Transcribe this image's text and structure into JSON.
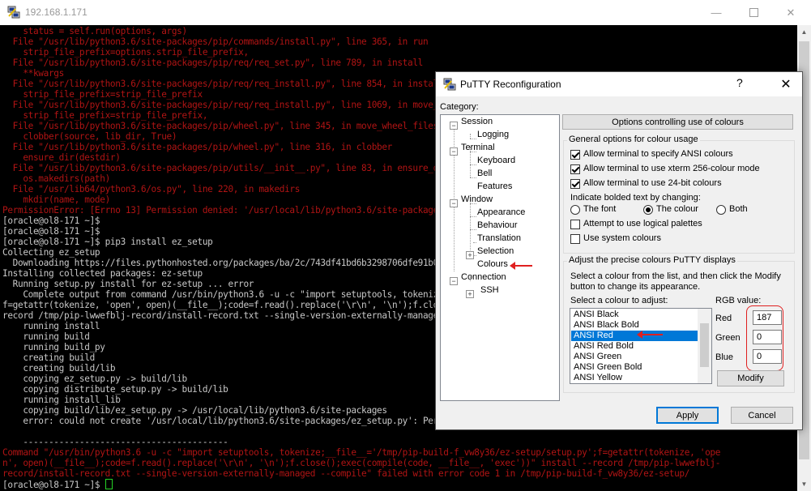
{
  "window": {
    "title": "192.168.1.171"
  },
  "terminal": {
    "lines": [
      {
        "text": "    status = self.run(options, args)",
        "color": "red"
      },
      {
        "text": "  File \"/usr/lib/python3.6/site-packages/pip/commands/install.py\", line 365, in run",
        "color": "red"
      },
      {
        "text": "    strip_file_prefix=options.strip_file_prefix,",
        "color": "red"
      },
      {
        "text": "  File \"/usr/lib/python3.6/site-packages/pip/req/req_set.py\", line 789, in install",
        "color": "red"
      },
      {
        "text": "    **kwargs",
        "color": "red"
      },
      {
        "text": "  File \"/usr/lib/python3.6/site-packages/pip/req/req_install.py\", line 854, in install",
        "color": "red"
      },
      {
        "text": "    strip_file_prefix=strip_file_prefix",
        "color": "red"
      },
      {
        "text": "  File \"/usr/lib/python3.6/site-packages/pip/req/req_install.py\", line 1069, in move_wheel_files",
        "color": "red"
      },
      {
        "text": "    strip_file_prefix=strip_file_prefix,",
        "color": "red"
      },
      {
        "text": "  File \"/usr/lib/python3.6/site-packages/pip/wheel.py\", line 345, in move_wheel_files",
        "color": "red"
      },
      {
        "text": "    clobber(source, lib_dir, True)",
        "color": "red"
      },
      {
        "text": "  File \"/usr/lib/python3.6/site-packages/pip/wheel.py\", line 316, in clobber",
        "color": "red"
      },
      {
        "text": "    ensure_dir(destdir)",
        "color": "red"
      },
      {
        "text": "  File \"/usr/lib/python3.6/site-packages/pip/utils/__init__.py\", line 83, in ensure_dir",
        "color": "red"
      },
      {
        "text": "    os.makedirs(path)",
        "color": "red"
      },
      {
        "text": "  File \"/usr/lib64/python3.6/os.py\", line 220, in makedirs",
        "color": "red"
      },
      {
        "text": "    mkdir(name, mode)",
        "color": "red"
      },
      {
        "text": "PermissionError: [Errno 13] Permission denied: '/usr/local/lib/python3.6/site-packages'",
        "color": "red"
      },
      {
        "text": "[oracle@ol8-171 ~]$",
        "color": "gray"
      },
      {
        "text": "[oracle@ol8-171 ~]$",
        "color": "gray"
      },
      {
        "text": "[oracle@ol8-171 ~]$ pip3 install ez_setup",
        "color": "gray"
      },
      {
        "text": "Collecting ez_setup",
        "color": "gray"
      },
      {
        "text": "  Downloading https://files.pythonhosted.org/packages/ba/2c/743df41bd6b3298706dfe91b0c7ecdc47f2dc1",
        "color": "gray"
      },
      {
        "text": "Installing collected packages: ez-setup",
        "color": "gray"
      },
      {
        "text": "  Running setup.py install for ez-setup ... error",
        "color": "gray"
      },
      {
        "text": "    Complete output from command /usr/bin/python3.6 -u -c \"import setuptools, tokenize;__file__='/tmp",
        "color": "gray"
      },
      {
        "text": "f=getattr(tokenize, 'open', open)(__file__);code=f.read().replace('\\r\\n', '\\n');f.close();exec(compile(",
        "color": "gray"
      },
      {
        "text": "record /tmp/pip-lwwefblj-record/install-record.txt --single-version-externally-managed --compile:",
        "color": "gray"
      },
      {
        "text": "    running install",
        "color": "gray"
      },
      {
        "text": "    running build",
        "color": "gray"
      },
      {
        "text": "    running build_py",
        "color": "gray"
      },
      {
        "text": "    creating build",
        "color": "gray"
      },
      {
        "text": "    creating build/lib",
        "color": "gray"
      },
      {
        "text": "    copying ez_setup.py -> build/lib",
        "color": "gray"
      },
      {
        "text": "    copying distribute_setup.py -> build/lib",
        "color": "gray"
      },
      {
        "text": "    running install_lib",
        "color": "gray"
      },
      {
        "text": "    copying build/lib/ez_setup.py -> /usr/local/lib/python3.6/site-packages",
        "color": "gray"
      },
      {
        "text": "    error: could not create '/usr/local/lib/python3.6/site-packages/ez_setup.py': Permission denied",
        "color": "gray"
      },
      {
        "text": "",
        "color": "gray"
      },
      {
        "text": "    ----------------------------------------",
        "color": "gray"
      },
      {
        "text": "Command \"/usr/bin/python3.6 -u -c \"import setuptools, tokenize;__file__='/tmp/pip-build-f_vw8y36/ez-setup/setup.py';f=getattr(tokenize, 'ope",
        "color": "red"
      },
      {
        "text": "n', open)(__file__);code=f.read().replace('\\r\\n', '\\n');f.close();exec(compile(code, __file__, 'exec'))\" install --record /tmp/pip-lwwefblj-",
        "color": "red"
      },
      {
        "text": "record/install-record.txt --single-version-externally-managed --compile\" failed with error code 1 in /tmp/pip-build-f_vw8y36/ez-setup/",
        "color": "red"
      }
    ],
    "prompt": "[oracle@ol8-171 ~]$ "
  },
  "dialog": {
    "title": "PuTTY Reconfiguration",
    "help": "?",
    "close": "✕",
    "category_label": "Category:",
    "tree": [
      "Session",
      "Logging",
      "Terminal",
      "Keyboard",
      "Bell",
      "Features",
      "Window",
      "Appearance",
      "Behaviour",
      "Translation",
      "Selection",
      "Colours",
      "Connection",
      "SSH"
    ],
    "panel_header": "Options controlling use of colours",
    "general_group": "General options for colour usage",
    "checks": [
      {
        "label": "Allow terminal to specify ANSI colours",
        "checked": true
      },
      {
        "label": "Allow terminal to use xterm 256-colour mode",
        "checked": true
      },
      {
        "label": "Allow terminal to use 24-bit colours",
        "checked": true
      }
    ],
    "bold_label": "Indicate bolded text by changing:",
    "bold_options": [
      {
        "label": "The font",
        "selected": false
      },
      {
        "label": "The colour",
        "selected": true
      },
      {
        "label": "Both",
        "selected": false
      }
    ],
    "logical_palettes": {
      "label": "Attempt to use logical palettes",
      "checked": false
    },
    "system_colours": {
      "label": "Use system colours",
      "checked": false
    },
    "adjust_group": "Adjust the precise colours PuTTY displays",
    "adjust_desc1": "Select a colour from the list, and then click the Modify",
    "adjust_desc2": "button to change its appearance.",
    "select_label": "Select a colour to adjust:",
    "colours": [
      "ANSI Black",
      "ANSI Black Bold",
      "ANSI Red",
      "ANSI Red Bold",
      "ANSI Green",
      "ANSI Green Bold",
      "ANSI Yellow"
    ],
    "selected_colour": "ANSI Red",
    "rgb_label": "RGB value:",
    "rgb": {
      "red_label": "Red",
      "red": "187",
      "green_label": "Green",
      "green": "0",
      "blue_label": "Blue",
      "blue": "0"
    },
    "modify": "Modify",
    "apply": "Apply",
    "cancel": "Cancel"
  },
  "colors": {
    "terminal_red": "#b01414",
    "terminal_gray": "#c8c8c8",
    "selection": "#0078d7",
    "annotation": "#e02020"
  }
}
